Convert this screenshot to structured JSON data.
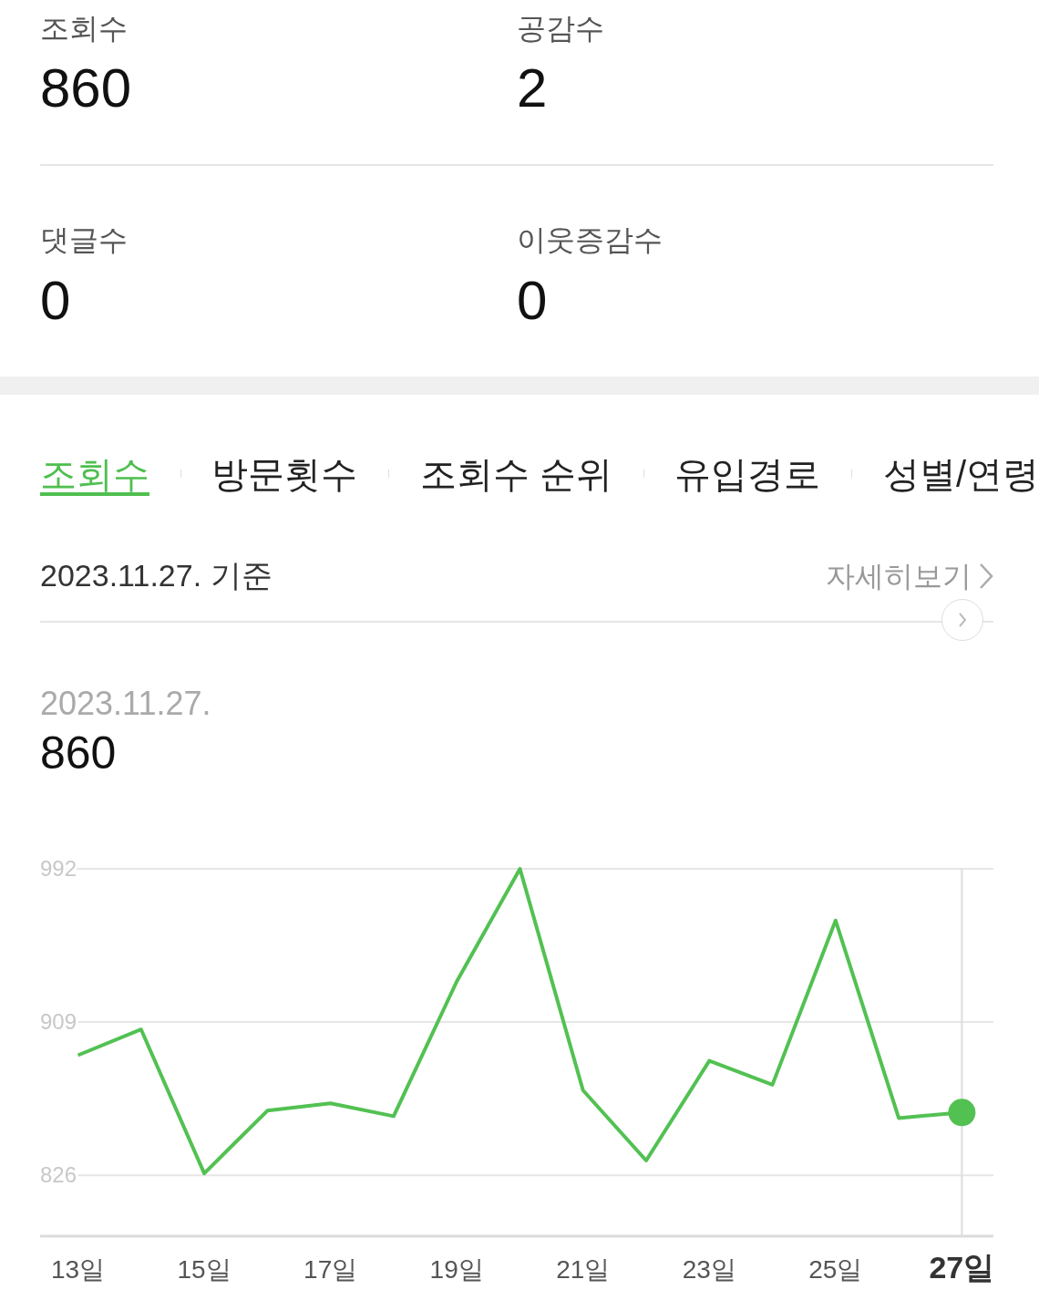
{
  "stats": [
    {
      "label": "조회수",
      "value": "860"
    },
    {
      "label": "공감수",
      "value": "2"
    },
    {
      "label": "댓글수",
      "value": "0"
    },
    {
      "label": "이웃증감수",
      "value": "0"
    }
  ],
  "tabs": [
    {
      "label": "조회수",
      "selected": true
    },
    {
      "label": "방문횟수",
      "selected": false
    },
    {
      "label": "조회수 순위",
      "selected": false
    },
    {
      "label": "유입경로",
      "selected": false
    },
    {
      "label": "성별/연령",
      "selected": false
    }
  ],
  "basis": {
    "date": "2023.11.27. 기준",
    "more_link": "자세히보기"
  },
  "selected_point": {
    "date": "2023.11.27.",
    "value": "860"
  },
  "chart_data": {
    "type": "line",
    "x": [
      13,
      14,
      15,
      16,
      17,
      18,
      19,
      20,
      21,
      22,
      23,
      24,
      25,
      26,
      27
    ],
    "series": [
      {
        "color": "#52c152",
        "values": [
          891,
          905,
          827,
          861,
          865,
          858,
          931,
          992,
          872,
          834,
          888,
          875,
          964,
          857,
          860
        ]
      }
    ],
    "xlim": [
      12.4,
      27.5
    ],
    "ylim": [
      793,
      992
    ],
    "xticks": [
      {
        "value": 13,
        "label": "13일"
      },
      {
        "value": 15,
        "label": "15일"
      },
      {
        "value": 17,
        "label": "17일"
      },
      {
        "value": 19,
        "label": "19일"
      },
      {
        "value": 21,
        "label": "21일"
      },
      {
        "value": 23,
        "label": "23일"
      },
      {
        "value": 25,
        "label": "25일"
      },
      {
        "value": 27,
        "label": "27일"
      }
    ],
    "yticks": [
      826,
      909,
      992
    ],
    "ref_lines": [
      {
        "axis": "x",
        "value": 27
      }
    ]
  }
}
